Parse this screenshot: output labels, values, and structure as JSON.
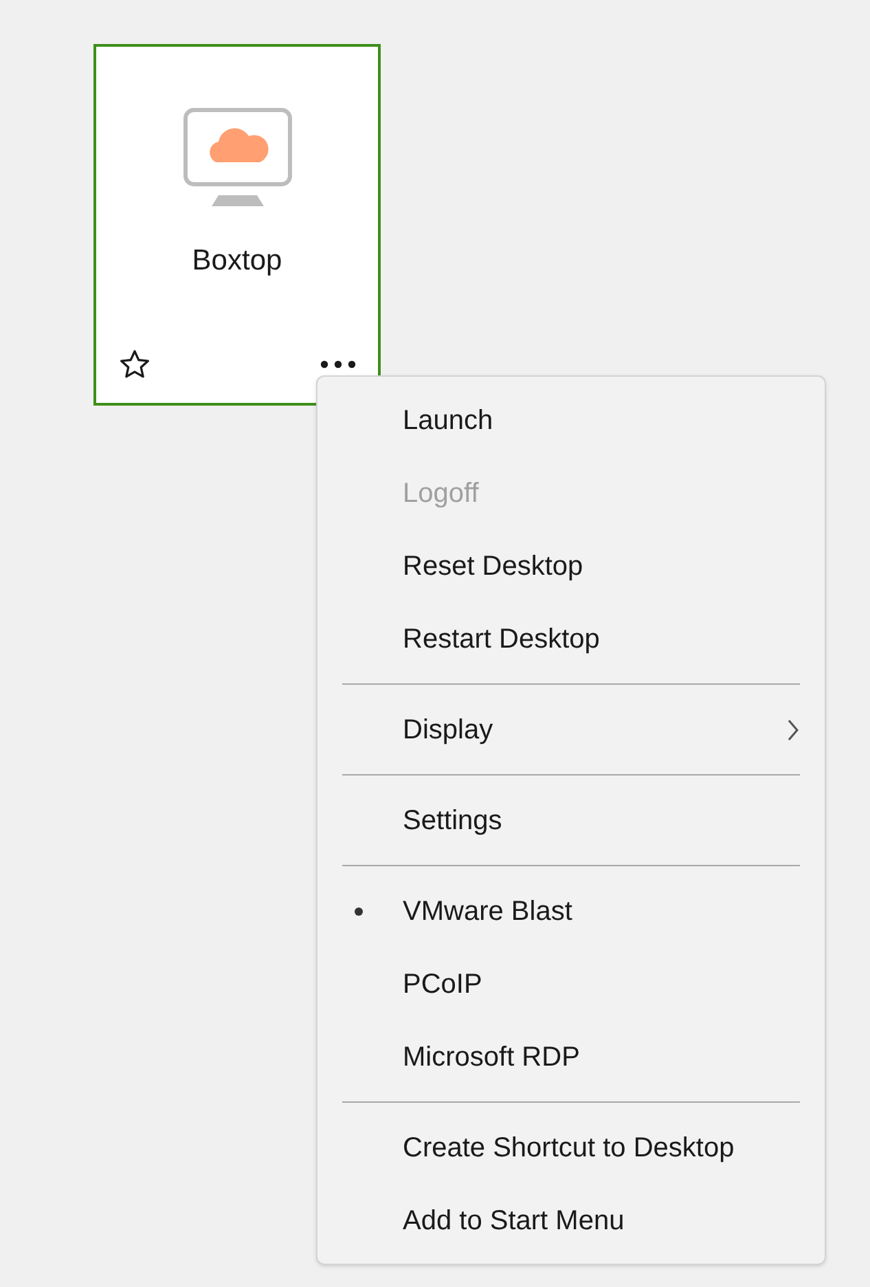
{
  "tile": {
    "title": "Boxtop",
    "selected": true,
    "favorite": false
  },
  "menu": {
    "sections": [
      [
        {
          "kind": "action",
          "label": "Launch",
          "disabled": false
        },
        {
          "kind": "action",
          "label": "Logoff",
          "disabled": true
        },
        {
          "kind": "action",
          "label": "Reset Desktop",
          "disabled": false
        },
        {
          "kind": "action",
          "label": "Restart Desktop",
          "disabled": false
        }
      ],
      [
        {
          "kind": "submenu",
          "label": "Display",
          "disabled": false
        }
      ],
      [
        {
          "kind": "action",
          "label": "Settings",
          "disabled": false
        }
      ],
      [
        {
          "kind": "radio",
          "label": "VMware Blast",
          "disabled": false,
          "selected": true
        },
        {
          "kind": "radio",
          "label": "PCoIP",
          "disabled": false,
          "selected": false
        },
        {
          "kind": "radio",
          "label": "Microsoft RDP",
          "disabled": false,
          "selected": false
        }
      ],
      [
        {
          "kind": "action",
          "label": "Create Shortcut to Desktop",
          "disabled": false
        },
        {
          "kind": "action",
          "label": "Add to Start Menu",
          "disabled": false
        }
      ]
    ]
  }
}
